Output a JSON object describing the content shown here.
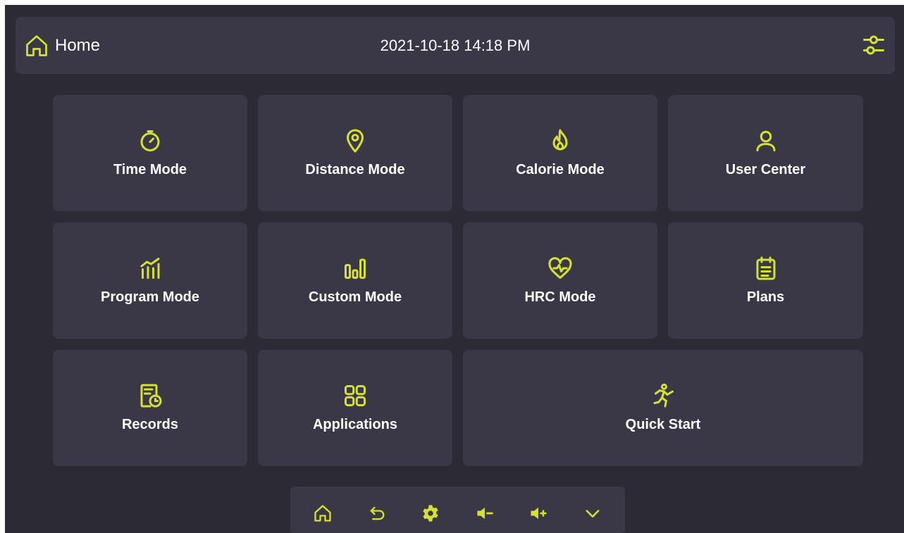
{
  "theme": {
    "accent": "#d7e22f",
    "panel": "#3a3846",
    "background": "#2b2a35"
  },
  "header": {
    "home_label": "Home",
    "datetime": "2021-10-18 14:18 PM"
  },
  "tiles": [
    {
      "label": "Time Mode",
      "icon": "stopwatch-icon"
    },
    {
      "label": "Distance Mode",
      "icon": "location-pin-icon"
    },
    {
      "label": "Calorie Mode",
      "icon": "flame-icon"
    },
    {
      "label": "User Center",
      "icon": "user-icon"
    },
    {
      "label": "Program Mode",
      "icon": "program-chart-icon"
    },
    {
      "label": "Custom Mode",
      "icon": "custom-bars-icon"
    },
    {
      "label": "HRC Mode",
      "icon": "heart-rate-icon"
    },
    {
      "label": "Plans",
      "icon": "clipboard-icon"
    },
    {
      "label": "Records",
      "icon": "records-clock-icon"
    },
    {
      "label": "Applications",
      "icon": "apps-grid-icon"
    },
    {
      "label": "Quick Start",
      "icon": "runner-icon"
    }
  ],
  "dock": [
    "home-icon",
    "back-icon",
    "gear-icon",
    "volume-down-icon",
    "volume-up-icon",
    "chevron-down-icon"
  ]
}
